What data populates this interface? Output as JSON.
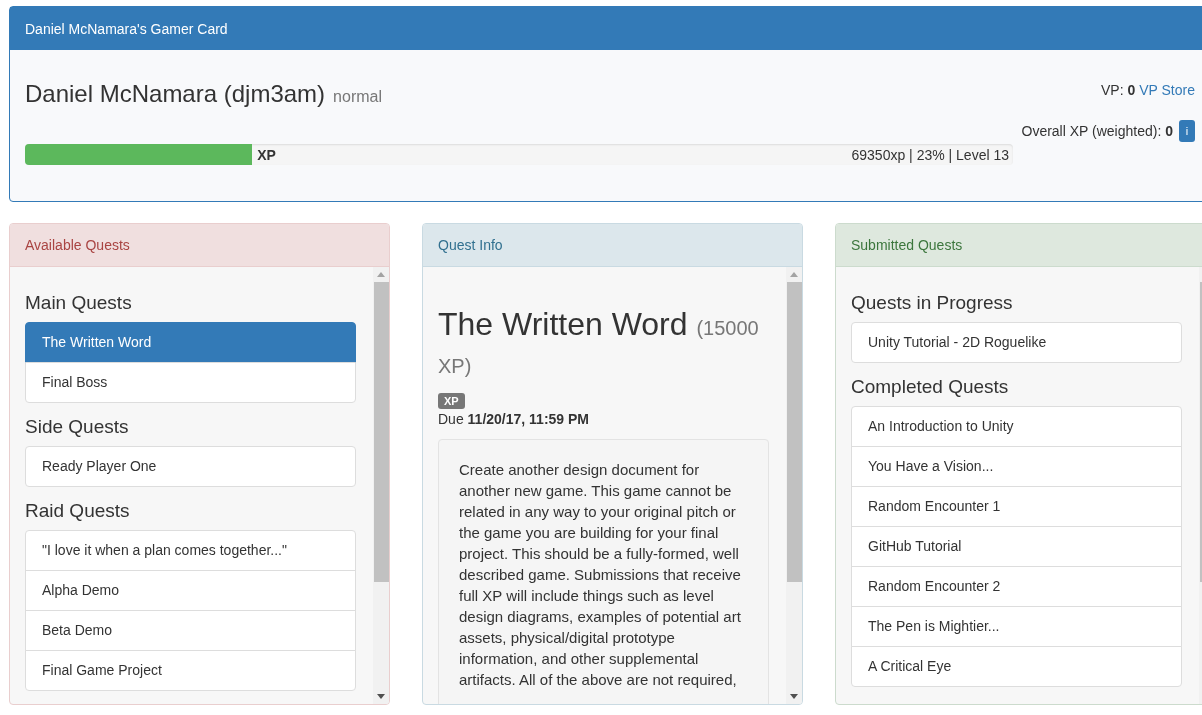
{
  "gamer_card": {
    "title": "Daniel McNamara's Gamer Card",
    "name": "Daniel McNamara (djm3am)",
    "mode": "normal",
    "vp_label": "VP:",
    "vp_value": "0",
    "vp_store_link": "VP Store",
    "overall_xp_label": "Overall XP (weighted):",
    "overall_xp_value": "0",
    "info_button": "i",
    "xp_bar": {
      "label": "XP",
      "level": 0.23,
      "reading": "69350xp | 23% | Level 13"
    }
  },
  "panels": [
    {
      "kind": "list",
      "color": "#a94442",
      "title": "Available Quests",
      "groups": [
        {
          "heading": "Main Quests",
          "items": [
            {
              "label": "The Written Word",
              "selected": true
            },
            {
              "label": "Final Boss",
              "selected": false
            }
          ]
        },
        {
          "heading": "Side Quests",
          "items": [
            {
              "label": "Ready Player One",
              "selected": false
            }
          ]
        },
        {
          "heading": "Raid Quests",
          "items": [
            {
              "label": "\"I love it when a plan comes together...\"",
              "selected": false
            },
            {
              "label": "Alpha Demo",
              "selected": false
            },
            {
              "label": "Beta Demo",
              "selected": false
            },
            {
              "label": "Final Game Project",
              "selected": false
            }
          ]
        }
      ]
    },
    {
      "kind": "detail",
      "color": "#31708f",
      "title": "Quest Info",
      "quest": {
        "title": "The Written Word",
        "xp": "(15000 XP)",
        "badge": "XP",
        "due_label": "Due",
        "due_value": "11/20/17, 11:59 PM",
        "description": "Create another design document for another new game. This game cannot be related in any way to your original pitch or the game you are building for your final project. This should be a fully-formed, well described game. Submissions that receive full XP will include things such as level design diagrams, examples of potential art assets, physical/digital prototype information, and other supplemental artifacts. All of the above are not required,"
      }
    },
    {
      "kind": "list",
      "color": "#3c763d",
      "title": "Submitted Quests",
      "groups": [
        {
          "heading": "Quests in Progress",
          "items": [
            {
              "label": "Unity Tutorial - 2D Roguelike",
              "selected": false
            }
          ]
        },
        {
          "heading": "Completed Quests",
          "items": [
            {
              "label": "An Introduction to Unity",
              "selected": false
            },
            {
              "label": "You Have a Vision...",
              "selected": false
            },
            {
              "label": "Random Encounter 1",
              "selected": false
            },
            {
              "label": "GitHub Tutorial",
              "selected": false
            },
            {
              "label": "Random Encounter 2",
              "selected": false
            },
            {
              "label": "The Pen is Mightier...",
              "selected": false
            },
            {
              "label": "A Critical Eye",
              "selected": false
            }
          ]
        }
      ]
    }
  ]
}
